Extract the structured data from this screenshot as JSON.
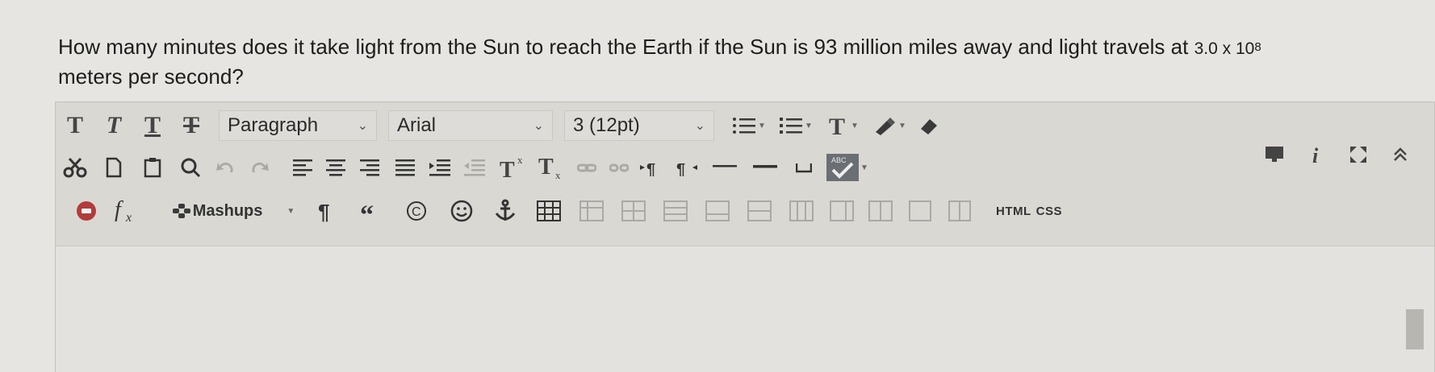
{
  "question": {
    "text": "How many minutes does it take light from the Sun to reach the Earth if the Sun is 93 million miles away and light travels at",
    "sci_value": "3.0 x 10",
    "sci_exponent": "8",
    "line2": "meters per second?"
  },
  "toolbar": {
    "format_labels": [
      "T",
      "T",
      "T",
      "T"
    ],
    "paragraph_select": "Paragraph",
    "font_select": "Arial",
    "size_select": "3 (12pt)",
    "mashups_label": "Mashups",
    "html_label": "HTML",
    "css_label": "CSS",
    "spell_label": "ABC"
  },
  "colors": {
    "icon": "#3a3a3a",
    "record": "#b23b3b",
    "background": "#e7e5e1"
  }
}
